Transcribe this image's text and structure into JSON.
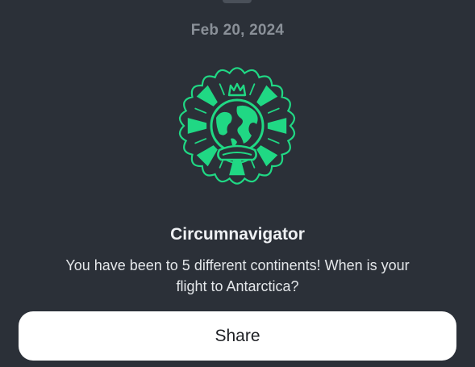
{
  "achievement": {
    "date": "Feb 20, 2024",
    "title": "Circumnavigator",
    "description": "You have been to 5 different continents! When is your flight to Antarctica?",
    "badge_icon": "globe-crown-badge-icon",
    "badge_color": "#20d884"
  },
  "actions": {
    "share_label": "Share"
  },
  "colors": {
    "background": "#2b3038",
    "date_text": "#8a9098",
    "title_text": "#eef0f3",
    "button_background": "#ffffff"
  }
}
